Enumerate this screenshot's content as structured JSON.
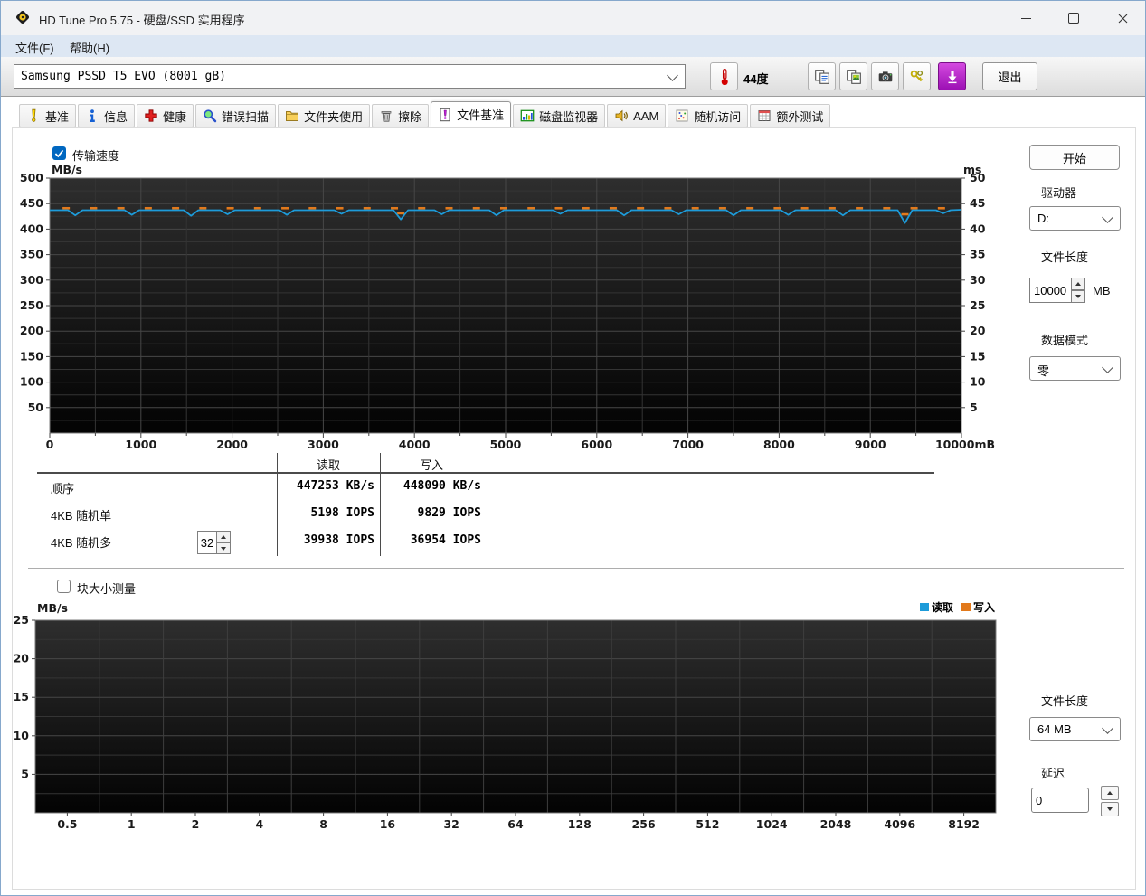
{
  "window": {
    "title": "HD Tune Pro 5.75 - 硬盘/SSD 实用程序"
  },
  "menu": {
    "file": "文件(F)",
    "help": "帮助(H)"
  },
  "toolbar": {
    "drive_selected": "Samsung PSSD T5 EVO (8001 gB)",
    "temperature": "44度",
    "exit_label": "退出"
  },
  "tabs": [
    {
      "label": "基准",
      "icon": "benchmark-icon",
      "active": false
    },
    {
      "label": "信息",
      "icon": "info-icon",
      "active": false
    },
    {
      "label": "健康",
      "icon": "health-icon",
      "active": false
    },
    {
      "label": "错误扫描",
      "icon": "error-scan-icon",
      "active": false
    },
    {
      "label": "文件夹使用",
      "icon": "folder-usage-icon",
      "active": false
    },
    {
      "label": "擦除",
      "icon": "erase-icon",
      "active": false
    },
    {
      "label": "文件基准",
      "icon": "file-benchmark-icon",
      "active": true
    },
    {
      "label": "磁盘监视器",
      "icon": "disk-monitor-icon",
      "active": false
    },
    {
      "label": "AAM",
      "icon": "aam-icon",
      "active": false
    },
    {
      "label": "随机访问",
      "icon": "random-access-icon",
      "active": false
    },
    {
      "label": "额外测试",
      "icon": "extra-tests-icon",
      "active": false
    }
  ],
  "benchmark": {
    "transfer_label": "传输速度",
    "start_label": "开始",
    "drive_label": "驱动器",
    "drive_value": "D:",
    "file_length_label": "文件长度",
    "file_length_value": "10000",
    "file_length_unit": "MB",
    "data_mode_label": "数据模式",
    "data_mode_value": "零",
    "table": {
      "col_read": "读取",
      "col_write": "写入",
      "rows": [
        {
          "label": "顺序",
          "read": "447253 KB/s",
          "write": "448090 KB/s"
        },
        {
          "label": "4KB 随机单",
          "read": "5198 IOPS",
          "write": "9829 IOPS"
        },
        {
          "label": "4KB 随机多",
          "queue_depth": "32",
          "read": "39938 IOPS",
          "write": "36954 IOPS"
        }
      ]
    }
  },
  "block_test": {
    "checkbox_label": "块大小测量",
    "file_length_label": "文件长度",
    "file_length_value": "64 MB",
    "delay_label": "延迟",
    "delay_value": "0"
  },
  "chart_data": [
    {
      "type": "line",
      "title": "传输速度",
      "ylabel_left": "MB/s",
      "ylabel_right": "ms",
      "ylim_left": [
        0,
        500
      ],
      "yticks_left": [
        50,
        100,
        150,
        200,
        250,
        300,
        350,
        400,
        450,
        500
      ],
      "ylim_right": [
        0,
        50
      ],
      "yticks_right": [
        5,
        10,
        15,
        20,
        25,
        30,
        35,
        40,
        45,
        50
      ],
      "xlim": [
        0,
        10000
      ],
      "xticks": [
        0,
        1000,
        2000,
        3000,
        4000,
        5000,
        6000,
        7000,
        8000,
        9000
      ],
      "xlabel_last": "10000mB",
      "grid": true,
      "series": [
        {
          "name": "读取",
          "color": "#1d9bd9",
          "style": "line",
          "unit": "MB/s",
          "base_value": 437,
          "dips": [
            [
              280,
              427
            ],
            [
              900,
              428
            ],
            [
              1550,
              426
            ],
            [
              1950,
              429
            ],
            [
              2600,
              428
            ],
            [
              3200,
              430
            ],
            [
              3850,
              419
            ],
            [
              4300,
              429
            ],
            [
              4900,
              427
            ],
            [
              5600,
              430
            ],
            [
              6300,
              427
            ],
            [
              6900,
              429
            ],
            [
              7500,
              427
            ],
            [
              8100,
              428
            ],
            [
              8700,
              427
            ],
            [
              9380,
              412
            ],
            [
              9800,
              431
            ]
          ]
        },
        {
          "name": "写入",
          "color": "#e2791b",
          "style": "dash-markers",
          "unit": "MB/s",
          "base_value": 441,
          "marker_xs": [
            180,
            480,
            780,
            1080,
            1380,
            1680,
            1980,
            2280,
            2580,
            2880,
            3180,
            3480,
            3780,
            4080,
            4380,
            4680,
            4980,
            5280,
            5580,
            5880,
            6180,
            6480,
            6780,
            7080,
            7380,
            7680,
            7980,
            8280,
            8580,
            8880,
            9180,
            9480,
            9780
          ],
          "marker_dips": [
            [
              3850,
              431
            ],
            [
              9380,
              429
            ]
          ]
        }
      ]
    },
    {
      "type": "line",
      "title": "块大小测量",
      "ylabel": "MB/s",
      "ylim": [
        0,
        25
      ],
      "yticks": [
        5,
        10,
        15,
        20,
        25
      ],
      "categories": [
        "0.5",
        "1",
        "2",
        "4",
        "8",
        "16",
        "32",
        "64",
        "128",
        "256",
        "512",
        "1024",
        "2048",
        "4096",
        "8192"
      ],
      "legend": [
        {
          "name": "读取",
          "color": "#1d9bd9"
        },
        {
          "name": "写入",
          "color": "#e2791b"
        }
      ],
      "series": []
    }
  ]
}
